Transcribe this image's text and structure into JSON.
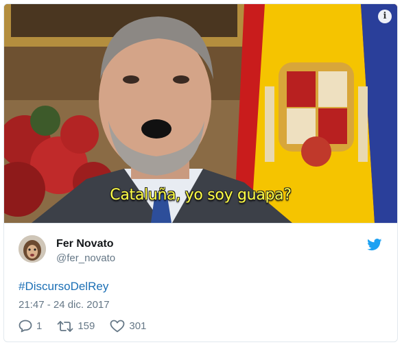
{
  "media": {
    "caption": "Cataluña, yo soy guapa?",
    "info_glyph": "i",
    "flag_colors": {
      "red": "#c91c1c",
      "yellow": "#f5c400"
    }
  },
  "tweet": {
    "display_name": "Fer Novato",
    "handle": "@fer_novato",
    "hashtag": "#DiscursoDelRey",
    "timestamp": "21:47 - 24 dic. 2017",
    "replies": "1",
    "retweets": "159",
    "likes": "301",
    "link_color": "#1b6fb5",
    "brand_color": "#1da1f2"
  },
  "icons": {
    "info": "info-icon",
    "brand": "twitter-bird-icon",
    "reply": "reply-icon",
    "retweet": "retweet-icon",
    "like": "heart-icon"
  }
}
